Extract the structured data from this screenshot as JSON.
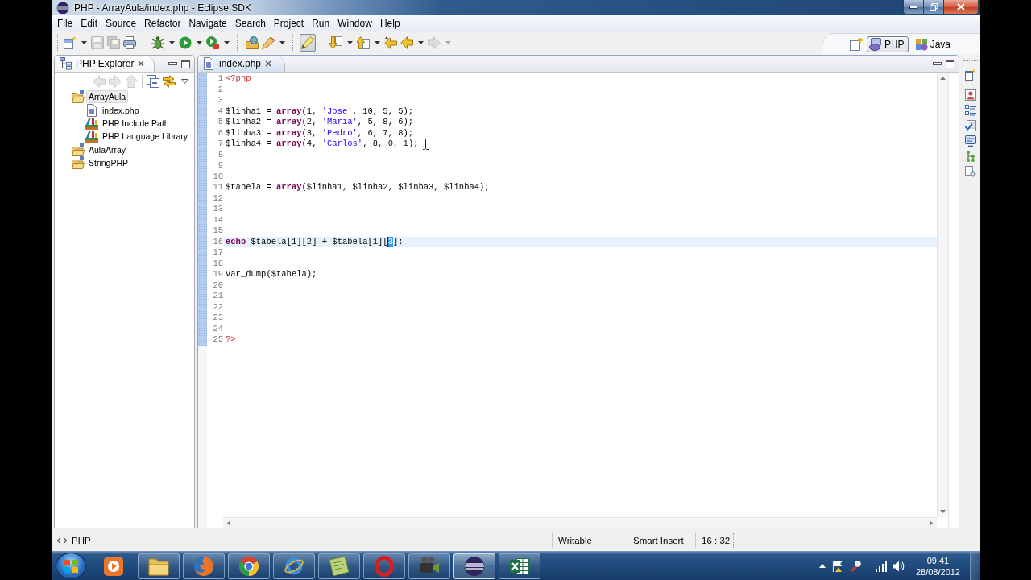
{
  "window": {
    "title": "PHP - ArrayAula/index.php - Eclipse SDK"
  },
  "menu": [
    "File",
    "Edit",
    "Source",
    "Refactor",
    "Navigate",
    "Search",
    "Project",
    "Run",
    "Window",
    "Help"
  ],
  "toolbar": [
    [
      {
        "kind": "new",
        "dropdown": true,
        "disabled": false,
        "pressed": false
      },
      {
        "kind": "save",
        "dropdown": false,
        "disabled": true,
        "pressed": false
      },
      {
        "kind": "save-all",
        "dropdown": false,
        "disabled": true,
        "pressed": false
      },
      {
        "kind": "print",
        "dropdown": false,
        "disabled": false,
        "pressed": false
      }
    ],
    [
      {
        "kind": "debug",
        "dropdown": true,
        "disabled": false,
        "pressed": false
      },
      {
        "kind": "run",
        "dropdown": true,
        "disabled": false,
        "pressed": false
      },
      {
        "kind": "external-tools",
        "dropdown": true,
        "disabled": false,
        "pressed": false
      }
    ],
    [
      {
        "kind": "open-type",
        "dropdown": false,
        "disabled": false,
        "pressed": false
      },
      {
        "kind": "search",
        "dropdown": true,
        "disabled": false,
        "pressed": false
      }
    ],
    [
      {
        "kind": "mark-occurrences",
        "dropdown": false,
        "disabled": false,
        "pressed": true
      }
    ],
    [
      {
        "kind": "next-annotation",
        "dropdown": true,
        "disabled": false,
        "pressed": false
      },
      {
        "kind": "previous-annotation",
        "dropdown": true,
        "disabled": false,
        "pressed": false
      },
      {
        "kind": "last-edit",
        "dropdown": false,
        "disabled": false,
        "pressed": false
      },
      {
        "kind": "back",
        "dropdown": true,
        "disabled": false,
        "pressed": false
      },
      {
        "kind": "forward",
        "dropdown": true,
        "disabled": true,
        "pressed": false
      }
    ]
  ],
  "perspectives": [
    {
      "kind": "php",
      "label": "PHP",
      "selected": true
    },
    {
      "kind": "java",
      "label": "Java",
      "selected": false
    }
  ],
  "explorer": {
    "title": "PHP Explorer",
    "toolbar": [
      [
        {
          "kind": "back",
          "disabled": true
        },
        {
          "kind": "forward",
          "disabled": true
        },
        {
          "kind": "up",
          "disabled": true
        }
      ],
      [
        {
          "kind": "collapse-all",
          "disabled": false
        },
        {
          "kind": "link",
          "disabled": false
        }
      ]
    ],
    "tree": [
      {
        "kind": "project",
        "label": "ArrayAula",
        "selected": true,
        "children": [
          {
            "kind": "php-file",
            "label": "index.php",
            "selected": false
          },
          {
            "kind": "library",
            "label": "PHP Include Path",
            "selected": false
          },
          {
            "kind": "library",
            "label": "PHP Language Library",
            "selected": false
          }
        ]
      },
      {
        "kind": "project",
        "label": "AulaArray",
        "selected": false
      },
      {
        "kind": "project",
        "label": "StringPHP",
        "selected": false
      }
    ]
  },
  "editor": {
    "tab": "index.php",
    "lines": [
      {
        "number": "1",
        "current": false,
        "tokens": [
          {
            "kind": "tag",
            "text": "<?php"
          }
        ]
      },
      {
        "number": "2",
        "current": false
      },
      {
        "number": "3",
        "current": false
      },
      {
        "number": "4",
        "current": false,
        "tokens": [
          {
            "kind": "plain",
            "text": "$linha1 = "
          },
          {
            "kind": "keyword",
            "text": "array"
          },
          {
            "kind": "plain",
            "text": "(1, "
          },
          {
            "kind": "string",
            "text": "'Jose'"
          },
          {
            "kind": "plain",
            "text": ", 10, 5, 5);"
          }
        ]
      },
      {
        "number": "5",
        "current": false,
        "tokens": [
          {
            "kind": "plain",
            "text": "$linha2 = "
          },
          {
            "kind": "keyword",
            "text": "array"
          },
          {
            "kind": "plain",
            "text": "(2, "
          },
          {
            "kind": "string",
            "text": "'Maria'"
          },
          {
            "kind": "plain",
            "text": ", 5, 8, 6);"
          }
        ]
      },
      {
        "number": "6",
        "current": false,
        "tokens": [
          {
            "kind": "plain",
            "text": "$linha3 = "
          },
          {
            "kind": "keyword",
            "text": "array"
          },
          {
            "kind": "plain",
            "text": "(3, "
          },
          {
            "kind": "string",
            "text": "'Pedro'"
          },
          {
            "kind": "plain",
            "text": ", 6, 7, 8);"
          }
        ]
      },
      {
        "number": "7",
        "current": false,
        "tokens": [
          {
            "kind": "plain",
            "text": "$linha4 = "
          },
          {
            "kind": "keyword",
            "text": "array"
          },
          {
            "kind": "plain",
            "text": "(4, "
          },
          {
            "kind": "string",
            "text": "'Carlos'"
          },
          {
            "kind": "plain",
            "text": ", 8, 0, 1);"
          }
        ]
      },
      {
        "number": "8",
        "current": false
      },
      {
        "number": "9",
        "current": false
      },
      {
        "number": "10",
        "current": false
      },
      {
        "number": "11",
        "current": false,
        "tokens": [
          {
            "kind": "plain",
            "text": "$tabela = "
          },
          {
            "kind": "keyword",
            "text": "array"
          },
          {
            "kind": "plain",
            "text": "($linha1, $linha2, $linha3, $linha4);"
          }
        ]
      },
      {
        "number": "12",
        "current": false
      },
      {
        "number": "13",
        "current": false
      },
      {
        "number": "14",
        "current": false
      },
      {
        "number": "15",
        "current": false
      },
      {
        "number": "16",
        "current": true,
        "tokens": [
          {
            "kind": "keyword",
            "text": "echo"
          },
          {
            "kind": "plain",
            "text": " $tabela[1][2] + $tabela[1]["
          },
          {
            "kind": "selection",
            "text": "3"
          },
          {
            "kind": "plain",
            "text": "];"
          }
        ]
      },
      {
        "number": "17",
        "current": false
      },
      {
        "number": "18",
        "current": false
      },
      {
        "number": "19",
        "current": false,
        "tokens": [
          {
            "kind": "plain",
            "text": "var_dump($tabela);"
          }
        ]
      },
      {
        "number": "20",
        "current": false
      },
      {
        "number": "21",
        "current": false
      },
      {
        "number": "22",
        "current": false
      },
      {
        "number": "23",
        "current": false
      },
      {
        "number": "24",
        "current": false
      },
      {
        "number": "25",
        "current": false,
        "tokens": [
          {
            "kind": "tag",
            "text": "?>"
          }
        ]
      }
    ]
  },
  "status_bar": {
    "context": "PHP",
    "fields": [
      "Writable",
      "Smart Insert",
      "16 : 32"
    ]
  },
  "taskbar": {
    "apps": [
      {
        "kind": "player",
        "running": false,
        "selected": false
      },
      {
        "kind": "folder",
        "running": true,
        "selected": false
      },
      {
        "kind": "firefox",
        "running": true,
        "selected": false
      },
      {
        "kind": "chrome",
        "running": true,
        "selected": false
      },
      {
        "kind": "ie",
        "running": true,
        "selected": false
      },
      {
        "kind": "notes",
        "running": true,
        "selected": false
      },
      {
        "kind": "opera",
        "running": true,
        "selected": false
      },
      {
        "kind": "camera",
        "running": true,
        "selected": false
      },
      {
        "kind": "eclipse",
        "running": true,
        "selected": true
      },
      {
        "kind": "excel",
        "running": true,
        "selected": false
      }
    ],
    "clock": {
      "time": "09:41",
      "date": "28/08/2012"
    }
  }
}
